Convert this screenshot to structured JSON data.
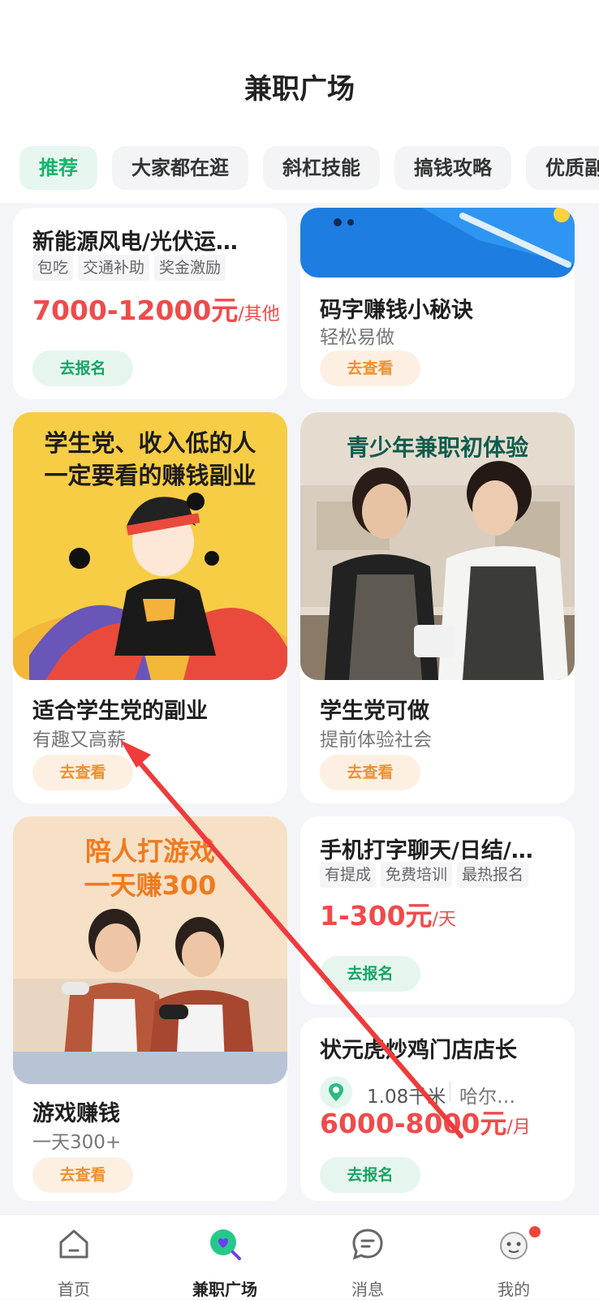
{
  "header": {
    "title": "兼职广场"
  },
  "tabs": [
    "推荐",
    "大家都在逛",
    "斜杠技能",
    "搞钱攻略",
    "优质副"
  ],
  "cards": {
    "c1": {
      "title": "新能源风电/光伏运…",
      "tags": [
        "包吃",
        "交通补助",
        "奖金激励"
      ],
      "salary": "7000-12000元",
      "unit": "/其他",
      "button": "去报名"
    },
    "c2": {
      "title": "码字赚钱小秘诀",
      "subtitle": "轻松易做",
      "button": "去查看"
    },
    "c3": {
      "image_text": [
        "学生党、收入低的人",
        "一定要看的赚钱副业"
      ],
      "title": "适合学生党的副业",
      "subtitle": "有趣又高薪",
      "button": "去查看"
    },
    "c4": {
      "image_text": "青少年兼职初体验",
      "title": "学生党可做",
      "subtitle": "提前体验社会",
      "button": "去查看"
    },
    "c5": {
      "image_text": [
        "陪人打游戏",
        "一天赚300"
      ],
      "title": "游戏赚钱",
      "subtitle": "一天300+",
      "button": "去查看"
    },
    "c6": {
      "title": "手机打字聊天/日结/…",
      "tags": [
        "有提成",
        "免费培训",
        "最热报名"
      ],
      "salary": "1-300元",
      "unit": "/天",
      "button": "去报名"
    },
    "c7": {
      "title": "状元虎炒鸡门店店长",
      "distance": "1.08千米",
      "city": "哈尔…",
      "salary": "6000-8000元",
      "unit": "/月",
      "button": "去报名"
    }
  },
  "nav": [
    {
      "label": "首页",
      "icon": "home-icon"
    },
    {
      "label": "兼职广场",
      "icon": "search-heart-icon"
    },
    {
      "label": "消息",
      "icon": "message-icon"
    },
    {
      "label": "我的",
      "icon": "profile-icon"
    }
  ],
  "colors": {
    "accent": "#12b56a",
    "price": "#ef4b4b",
    "orange": "#f0902b",
    "annotation_arrow": "#ef3b3b"
  }
}
